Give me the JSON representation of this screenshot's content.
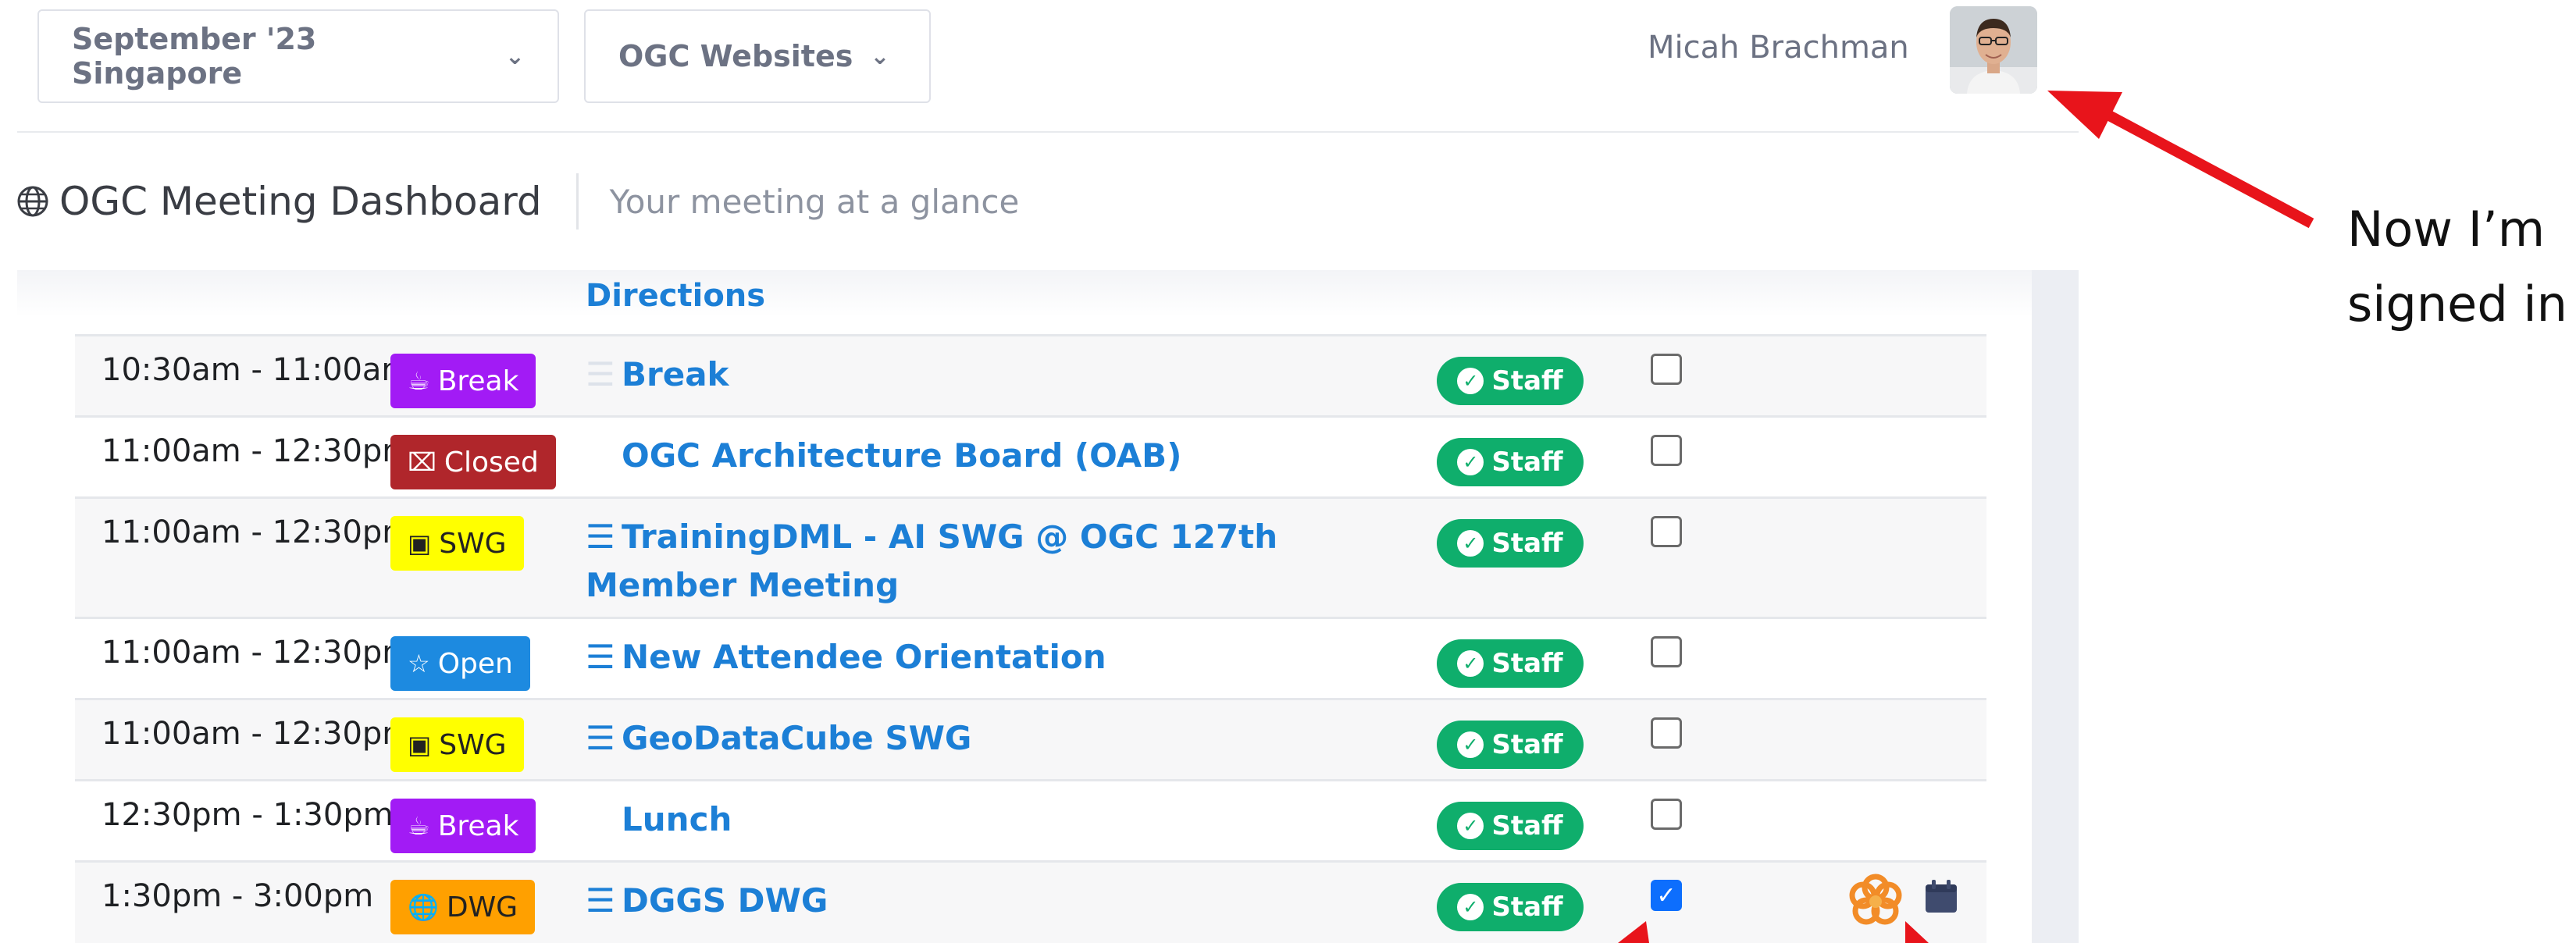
{
  "header": {
    "meeting_selector": "September '23 Singapore",
    "websites_selector": "OGC Websites",
    "user_name": "Micah Brachman"
  },
  "page": {
    "title": "OGC Meeting Dashboard",
    "subtitle": "Your meeting at a glance"
  },
  "schedule": {
    "directions_link": "Directions",
    "rows": [
      {
        "time": "10:30am - 11:00am",
        "badge": "Break",
        "badge_icon": "coffee-icon",
        "event": "Break",
        "list_icon": "faint",
        "status": "Staff",
        "checked": false
      },
      {
        "time": "11:00am - 12:30pm",
        "badge": "Closed",
        "badge_icon": "x-square-icon",
        "event": "OGC Architecture Board (OAB)",
        "list_icon": "none",
        "status": "Staff",
        "checked": false
      },
      {
        "time": "11:00am - 12:30pm",
        "badge": "SWG",
        "badge_icon": "robot-icon",
        "event": "TrainingDML - AI SWG @ OGC 127th Member Meeting",
        "list_icon": "list",
        "status": "Staff",
        "checked": false
      },
      {
        "time": "11:00am - 12:30pm",
        "badge": "Open",
        "badge_icon": "star-icon",
        "event": "New Attendee Orientation",
        "list_icon": "list",
        "status": "Staff",
        "checked": false
      },
      {
        "time": "11:00am - 12:30pm",
        "badge": "SWG",
        "badge_icon": "robot-icon",
        "event": "GeoDataCube SWG",
        "list_icon": "list",
        "status": "Staff",
        "checked": false
      },
      {
        "time": "12:30pm - 1:30pm",
        "badge": "Break",
        "badge_icon": "coffee-icon",
        "event": "Lunch",
        "list_icon": "none",
        "status": "Staff",
        "checked": false
      },
      {
        "time": "1:30pm - 3:00pm",
        "badge": "DWG",
        "badge_icon": "globe-icon",
        "event": "DGGS DWG",
        "list_icon": "list",
        "status": "Staff",
        "checked": true
      }
    ]
  },
  "annotation": {
    "line1": "Now I’m",
    "line2": "signed in"
  },
  "colors": {
    "link": "#1c7fd6",
    "staff_badge": "#0fae6c",
    "break_badge": "#a21bf5",
    "closed_badge": "#b0262b",
    "swg_badge": "#ffff00",
    "open_badge": "#1d8ae0",
    "dwg_badge": "#ffa000",
    "annotation_arrow": "#e8141b"
  }
}
